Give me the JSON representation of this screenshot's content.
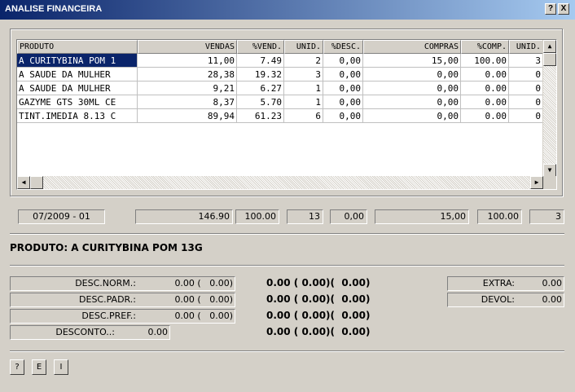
{
  "window": {
    "title": "ANALISE FINANCEIRA",
    "help_btn": "?",
    "close_btn": "X"
  },
  "grid": {
    "headers": [
      "PRODUTO",
      "VENDAS",
      "%VEND.",
      "UNID.",
      "%DESC.",
      "COMPRAS",
      "%COMP.",
      "UNID."
    ],
    "rows": [
      [
        "A CURITYBINA POM 1",
        "11,00",
        "7.49",
        "2",
        "0,00",
        "15,00",
        "100.00",
        "3"
      ],
      [
        "A SAUDE DA MULHER",
        "28,38",
        "19.32",
        "3",
        "0,00",
        "0,00",
        "0.00",
        "0"
      ],
      [
        "A SAUDE DA MULHER",
        "9,21",
        "6.27",
        "1",
        "0,00",
        "0,00",
        "0.00",
        "0"
      ],
      [
        "GAZYME GTS 30ML CE",
        "8,37",
        "5.70",
        "1",
        "0,00",
        "0,00",
        "0.00",
        "0"
      ],
      [
        "TINT.IMEDIA 8.13 C",
        "89,94",
        "61.23",
        "6",
        "0,00",
        "0,00",
        "0.00",
        "0"
      ]
    ]
  },
  "totals": [
    "07/2009 - 01",
    "146.90",
    "100.00",
    "13",
    "0,00",
    "15,00",
    "100.00",
    "3"
  ],
  "produto_label": "PRODUTO: A CURITYBINA POM 13G",
  "descontos": [
    {
      "label": "DESC.NORM.:",
      "value": "0.00 (   0.00)"
    },
    {
      "label": "DESC.PADR.:",
      "value": "0.00 (   0.00)"
    },
    {
      "label": "DESC.PREF.:",
      "value": "0.00 (   0.00)"
    },
    {
      "label": "DESCONTO..:",
      "value": "0.00"
    }
  ],
  "center_values": [
    "0.00 ( 0.00)(  0.00)",
    "0.00 ( 0.00)(  0.00)",
    "0.00 ( 0.00)(  0.00)",
    "0.00 ( 0.00)(  0.00)"
  ],
  "extras": [
    {
      "label": "EXTRA:",
      "value": "0.00"
    },
    {
      "label": "DEVOL:",
      "value": "0.00"
    }
  ],
  "buttons": [
    "?",
    "E",
    "I"
  ]
}
